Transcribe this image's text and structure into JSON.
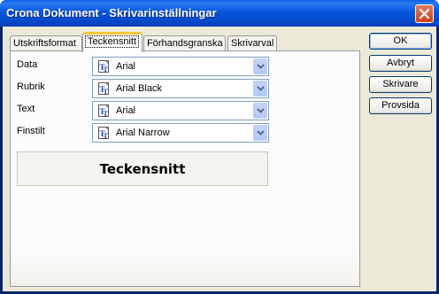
{
  "window": {
    "title": "Crona Dokument - Skrivarinställningar"
  },
  "tabs": [
    {
      "label": "Utskriftsformat"
    },
    {
      "label": "Teckensnitt"
    },
    {
      "label": "Förhandsgranska"
    },
    {
      "label": "Skrivarval"
    }
  ],
  "active_tab": "Teckensnitt",
  "fields": [
    {
      "label": "Data",
      "value": "Arial"
    },
    {
      "label": "Rubrik",
      "value": "Arial Black"
    },
    {
      "label": "Text",
      "value": "Arial"
    },
    {
      "label": "Finstilt",
      "value": "Arial Narrow"
    }
  ],
  "preview": {
    "text": "Teckensnitt"
  },
  "buttons": {
    "ok": "OK",
    "cancel": "Avbryt",
    "printer": "Skrivare",
    "test_page": "Provsida"
  },
  "icons": {
    "font": "truetype-font-icon",
    "dropdown": "chevron-down-icon",
    "close": "close-icon"
  },
  "colors": {
    "titlebar": "#0855dd",
    "dialog_bg": "#ece9d8",
    "active_tab_accent": "#ffc83c",
    "close_button": "#c9411d"
  }
}
